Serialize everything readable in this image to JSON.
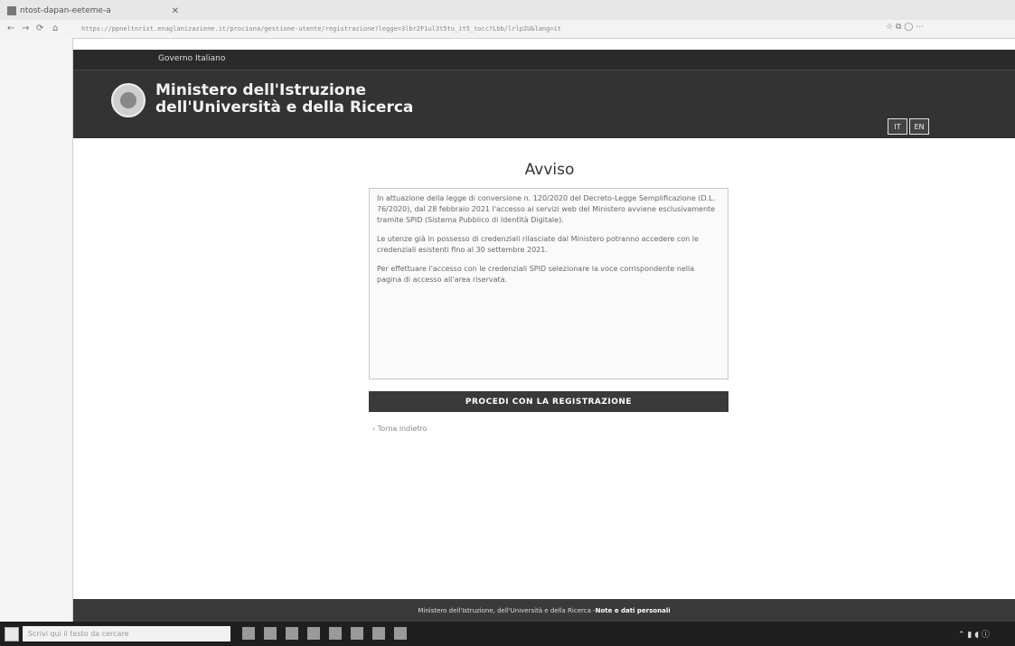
{
  "browser": {
    "tab_title": "ntost-dapan-eeteme-a",
    "url": "https://ppneltnrist.enaglanizaziene.it/prociona/gestione-utente/registrazione?legge=3lbr2F1ul3t5tu_it5_tocc?Lbb/lrlp2U&lang=it"
  },
  "header": {
    "gov_label": "Governo Italiano",
    "ministry_line1": "Ministero dell'Istruzione",
    "ministry_line2": "dell'Università e della Ricerca",
    "lang_options": [
      "IT",
      "EN"
    ]
  },
  "notice": {
    "title": "Avviso",
    "paragraphs": [
      "In attuazione della legge di conversione n. 120/2020 del Decreto-Legge Semplificazione (D.L. 76/2020), dal 28 febbraio 2021 l'accesso ai servizi web del Ministero avviene esclusivamente tramite SPID (Sistema Pubblico di Identità Digitale).",
      "Le utenze già in possesso di credenziali rilasciate dal Ministero potranno accedere con le credenziali esistenti fino al 30 settembre 2021.",
      "Per effettuare l'accesso con le credenziali SPID selezionare la voce corrispondente nella pagina di accesso all'area riservata."
    ]
  },
  "buttons": {
    "proceed": "PROCEDI CON LA REGISTRAZIONE",
    "back": "‹ Torna indietro"
  },
  "footer": {
    "text": "Ministero dell'Istruzione, dell'Università e della Ricerca - ",
    "link": "Note e dati personali"
  },
  "taskbar": {
    "search_placeholder": "Scrivi qui il testo da cercare"
  }
}
